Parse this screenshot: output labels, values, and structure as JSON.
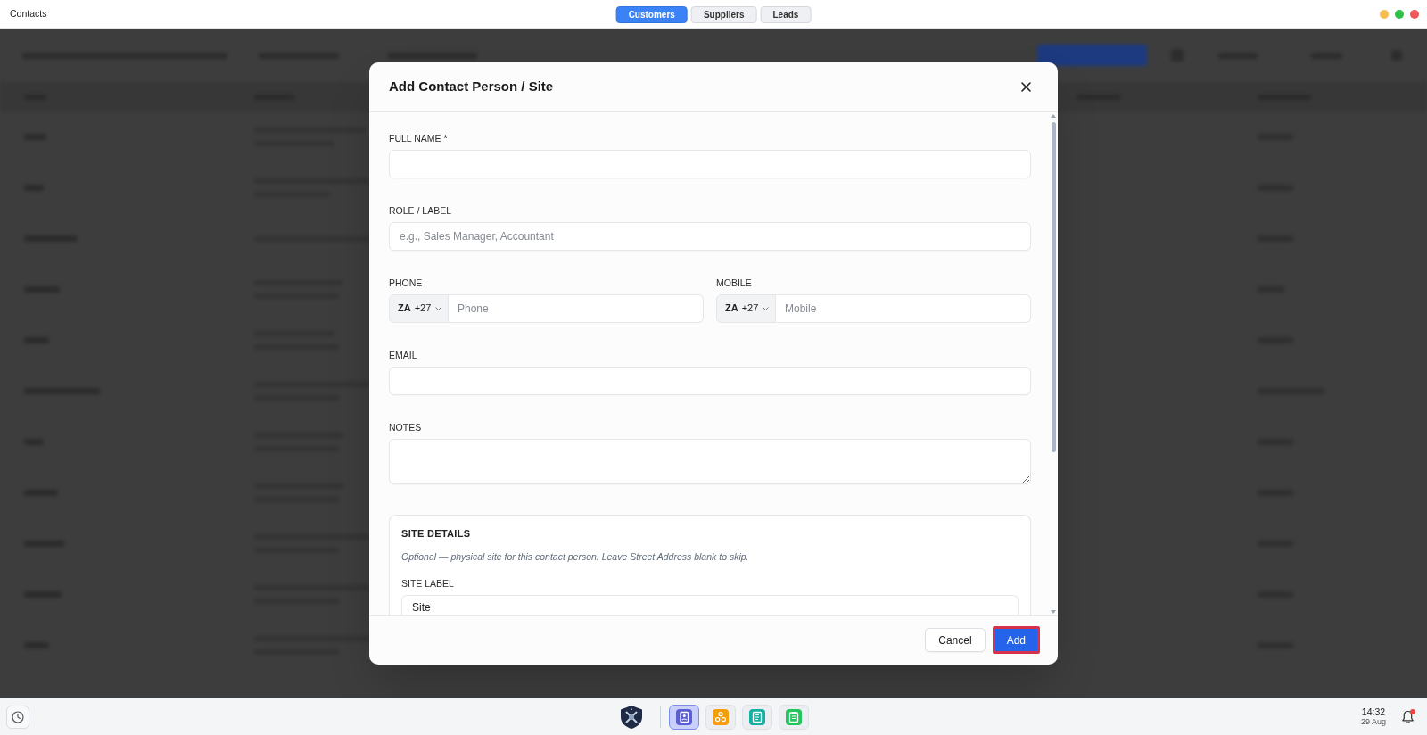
{
  "window": {
    "title": "Contacts"
  },
  "tabs": [
    {
      "label": "Customers",
      "selected": true
    },
    {
      "label": "Suppliers",
      "selected": false
    },
    {
      "label": "Leads",
      "selected": false
    }
  ],
  "dialog": {
    "title": "Add Contact Person / Site",
    "fields": [
      {
        "kind": "text",
        "label": "FULL NAME *"
      },
      {
        "kind": "text",
        "label": "ROLE / LABEL",
        "placeholder": "e.g., Sales Manager, Accountant"
      },
      {
        "kind": "phone_pair",
        "items": [
          {
            "label": "PHONE",
            "country": "ZA",
            "dial_code": "+27",
            "placeholder": "Phone"
          },
          {
            "label": "MOBILE",
            "country": "ZA",
            "dial_code": "+27",
            "placeholder": "Mobile"
          }
        ]
      },
      {
        "kind": "text",
        "label": "EMAIL"
      },
      {
        "kind": "textarea",
        "label": "NOTES"
      }
    ],
    "site_details": {
      "title": "SITE DETAILS",
      "note": "Optional — physical site for this contact person. Leave Street Address blank to skip.",
      "fields": [
        {
          "label": "SITE LABEL",
          "value": "Site"
        }
      ]
    },
    "buttons": [
      {
        "kind": "secondary",
        "label": "Cancel",
        "highlighted": false
      },
      {
        "kind": "primary",
        "label": "Add",
        "highlighted": true
      }
    ]
  },
  "taskbar": {
    "apps": [
      {
        "kind": "book",
        "selected": true
      },
      {
        "kind": "nodes",
        "selected": false
      },
      {
        "kind": "ledger",
        "selected": false
      },
      {
        "kind": "clipboard",
        "selected": false
      }
    ],
    "clock": {
      "time": "14:32",
      "date": "29 Aug"
    },
    "notifications": {
      "unread": true
    }
  }
}
